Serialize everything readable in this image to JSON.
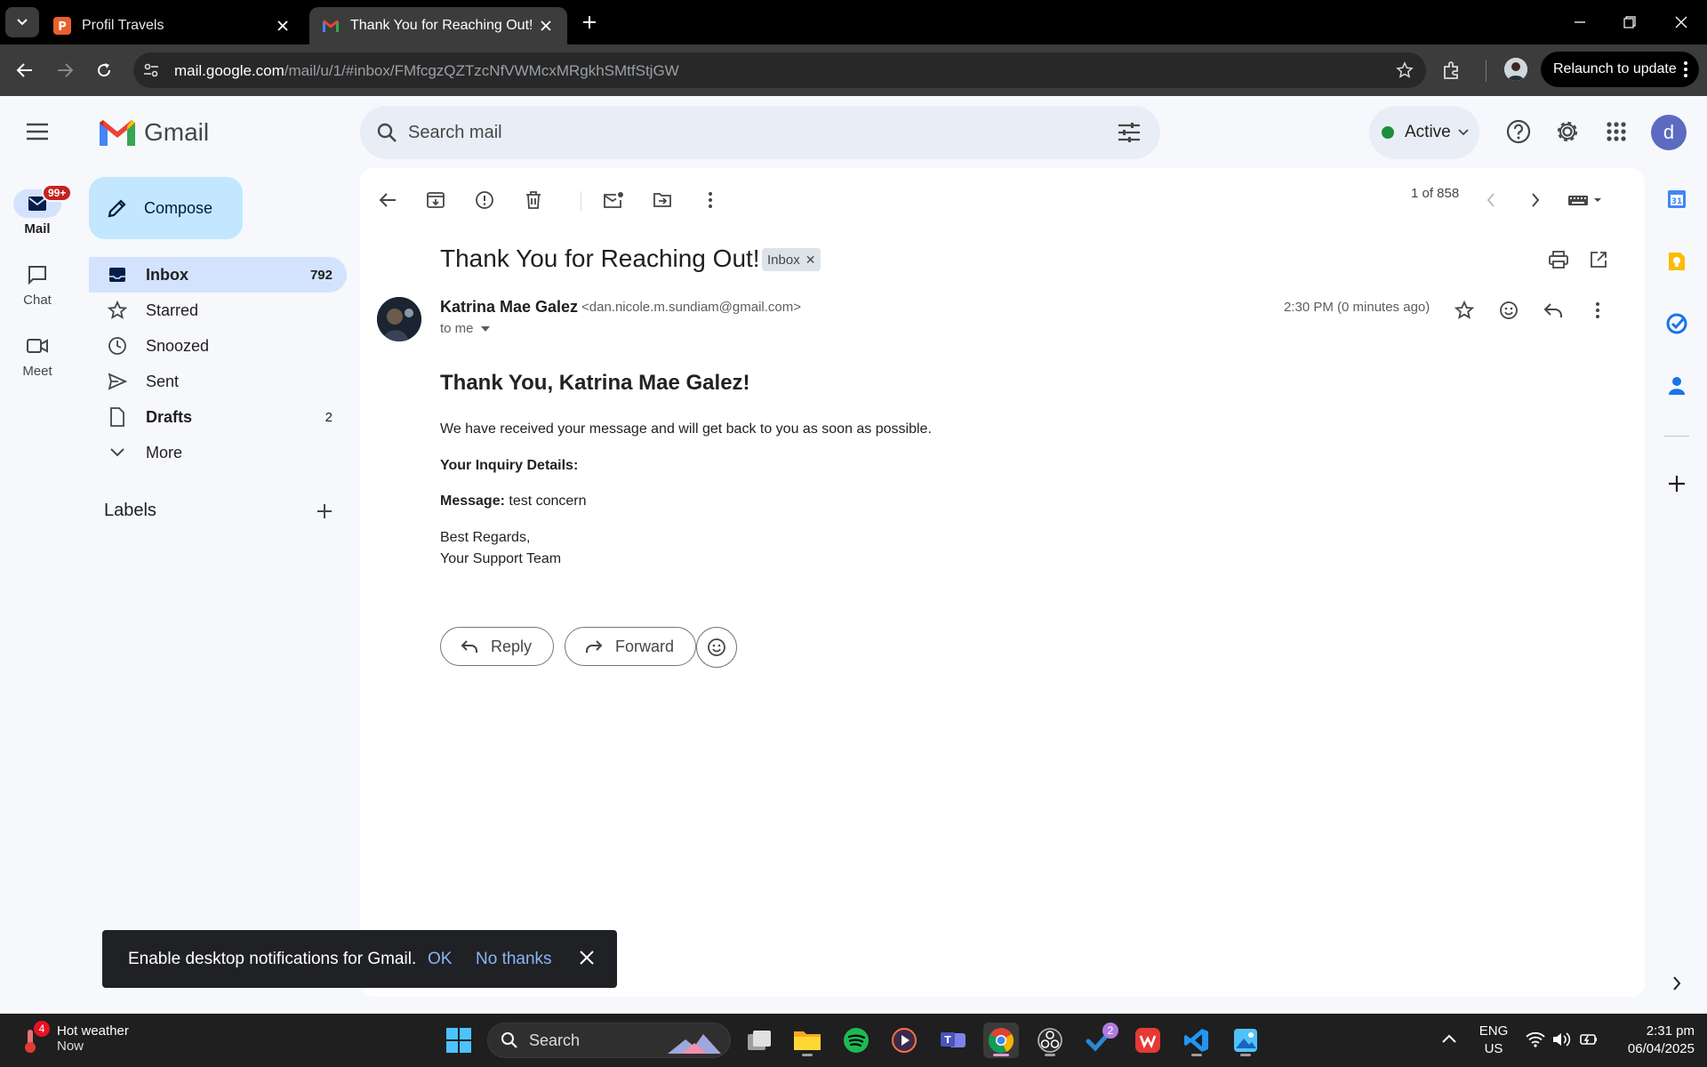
{
  "browser": {
    "tabs": [
      {
        "title": "Profil Travels",
        "active": false
      },
      {
        "title": "Thank You for Reaching Out! - d",
        "active": true
      }
    ],
    "url_host": "mail.google.com",
    "url_path": "/mail/u/1/#inbox/FMfcgzQZTzcNfVWMcxMRgkhSMtfStjGW",
    "relaunch_label": "Relaunch to update"
  },
  "header": {
    "logo_text": "Gmail",
    "search_placeholder": "Search mail",
    "status_label": "Active",
    "avatar_letter": "d",
    "status_color": "#1e8e3e"
  },
  "rail": {
    "mail_label": "Mail",
    "mail_badge": "99+",
    "chat_label": "Chat",
    "meet_label": "Meet"
  },
  "nav": {
    "compose_label": "Compose",
    "items": [
      {
        "label": "Inbox",
        "count": "792",
        "icon": "inbox-icon"
      },
      {
        "label": "Starred",
        "count": "",
        "icon": "star-icon"
      },
      {
        "label": "Snoozed",
        "count": "",
        "icon": "clock-icon"
      },
      {
        "label": "Sent",
        "count": "",
        "icon": "send-icon"
      },
      {
        "label": "Drafts",
        "count": "2",
        "icon": "file-icon"
      },
      {
        "label": "More",
        "count": "",
        "icon": "chevron-down-icon"
      }
    ],
    "labels_title": "Labels"
  },
  "toolbar": {
    "pager": "1 of 858"
  },
  "email": {
    "subject": "Thank You for Reaching Out!",
    "label_chip": "Inbox",
    "sender_name": "Katrina Mae Galez",
    "sender_email": "<dan.nicole.m.sundiam@gmail.com>",
    "to_line": "to me",
    "time": "2:30 PM (0 minutes ago)",
    "body": {
      "heading": "Thank You, Katrina Mae Galez!",
      "line1": "We have received your message and will get back to you as soon as possible.",
      "details_label": "Your Inquiry Details:",
      "message_label": "Message:",
      "message_value": " test concern",
      "regards": "Best Regards,",
      "team": "Your Support Team"
    },
    "reply_label": "Reply",
    "forward_label": "Forward"
  },
  "toast": {
    "text": "Enable desktop notifications for Gmail.",
    "ok": "OK",
    "no_thanks": "No thanks"
  },
  "taskbar": {
    "weather_badge": "4",
    "weather_title": "Hot weather",
    "weather_sub": "Now",
    "search_label": "Search",
    "todo_badge": "2",
    "lang_line1": "ENG",
    "lang_line2": "US",
    "time": "2:31 pm",
    "date": "06/04/2025"
  }
}
